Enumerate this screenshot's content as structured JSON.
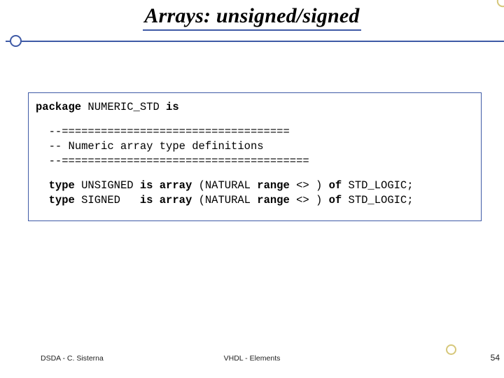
{
  "header": {
    "title": "Arrays: unsigned/signed"
  },
  "code": {
    "pkg_kw1": "package",
    "pkg_name": " NUMERIC_STD ",
    "pkg_kw2": "is",
    "sep1": "--===================================",
    "comment": "-- Numeric array type definitions",
    "sep2": "--======================================",
    "l1_kw1": "type",
    "l1_name": " UNSIGNED ",
    "l1_kw2": "is array",
    "l1_mid": " (NATURAL ",
    "l1_kw3": "range",
    "l1_tail1": " <> ) ",
    "l1_kw4": "of",
    "l1_tail2": " STD_LOGIC;",
    "l2_kw1": "type",
    "l2_name": " SIGNED   ",
    "l2_kw2": "is array",
    "l2_mid": " (NATURAL ",
    "l2_kw3": "range",
    "l2_tail1": " <> ) ",
    "l2_kw4": "of",
    "l2_tail2": " STD_LOGIC;"
  },
  "footer": {
    "left": "DSDA - C. Sisterna",
    "center": "VHDL - Elements",
    "page": "54"
  }
}
